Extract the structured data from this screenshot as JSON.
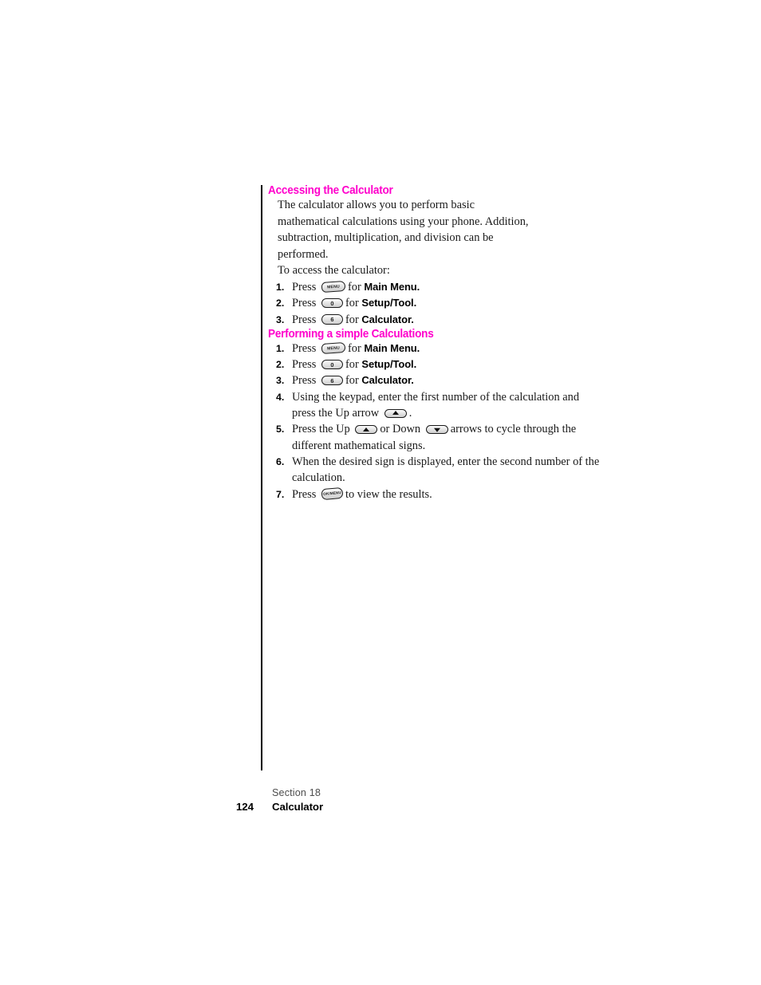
{
  "document": {
    "sections": [
      {
        "id": "accessing-the-calculator",
        "heading": "Accessing the Calculator",
        "paragraphs": [
          "The calculator allows you to perform basic mathematical calculations using your phone. Addition, subtraction, multiplication, and division can be performed.",
          "To access the calculator:"
        ],
        "steps": [
          {
            "number": "1.",
            "pre": "Press",
            "key": "MENU",
            "key_type": "menu-key",
            "mid": "for",
            "target": "Main Menu."
          },
          {
            "number": "2.",
            "pre": "Press",
            "key": "0",
            "key_type": "number-key",
            "mid": "for",
            "target": "Setup/Tool."
          },
          {
            "number": "3.",
            "pre": "Press",
            "key": "6",
            "key_type": "number-key",
            "mid": "for",
            "target": "Calculator."
          }
        ]
      },
      {
        "id": "performing-a-simple-calculations",
        "heading": "Performing a simple Calculations",
        "paragraphs": [],
        "steps": [
          {
            "number": "1.",
            "pre": "Press",
            "key": "MENU",
            "key_type": "menu-key",
            "mid": "for",
            "target": "Main Menu."
          },
          {
            "number": "2.",
            "pre": "Press",
            "key": "0",
            "key_type": "number-key",
            "mid": "for",
            "target": "Setup/Tool."
          },
          {
            "number": "3.",
            "pre": "Press",
            "key": "6",
            "key_type": "number-key",
            "mid": "for",
            "target": "Calculator."
          },
          {
            "number": "4.",
            "pre": "Using the keypad, enter the first number of the calculation and press the Up arrow",
            "key": "up-arrow",
            "key_type": "arrow-key-up",
            "mid": ".",
            "target": ""
          },
          {
            "number": "5.",
            "pre": "Press the Up",
            "key": "up-arrow",
            "key_type": "arrow-key-up",
            "mid": "or Down",
            "key2": "down-arrow",
            "key2_type": "arrow-key-down",
            "post": "arrows to cycle through the different mathematical signs.",
            "target": ""
          },
          {
            "number": "6.",
            "pre": "When the desired sign is displayed, enter the second number of the calculation.",
            "key": "",
            "key_type": "",
            "mid": "",
            "target": ""
          },
          {
            "number": "7.",
            "pre": "Press",
            "key": "OK/MENU",
            "key_type": "ok-menu-key",
            "mid": "to view the results.",
            "target": ""
          }
        ]
      }
    ]
  },
  "footer": {
    "section_label": "Section 18",
    "page_number": "124",
    "chapter_title": "Calculator"
  },
  "colors": {
    "heading": "#ff00cc",
    "body_text": "#1a1a1a",
    "footer_section": "#4d4d4d",
    "rule": "#000000",
    "page_background": "#ffffff"
  },
  "keys": {
    "menu_label": "MENU",
    "ok_label": "OK/MENU",
    "zero_label": "0",
    "six_label": "6"
  }
}
